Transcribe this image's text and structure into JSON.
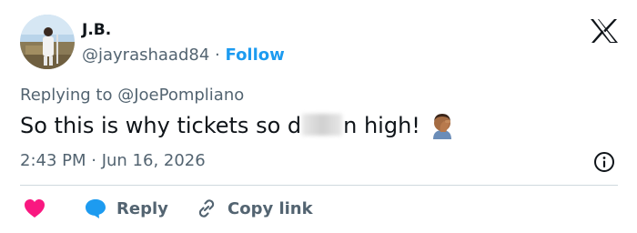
{
  "author": {
    "display_name": "J.B.",
    "handle": "@jayrashaad84",
    "separator": "·",
    "follow_label": "Follow"
  },
  "tweet": {
    "replying_prefix": "Replying to",
    "replying_to": "@JoePompliano",
    "text_before": "So this is why tickets so d",
    "text_after": "n high!",
    "emoji": "man-facepalming-emoji",
    "timestamp": "2:43 PM · Jun 16, 2026"
  },
  "actions": {
    "reply_label": "Reply",
    "copy_link_label": "Copy link"
  },
  "icons": {
    "logo": "x-logo",
    "info": "info-icon",
    "heart": "heart-icon",
    "reply": "reply-bubble-icon",
    "copy": "link-icon"
  },
  "colors": {
    "accent": "#1d9bf0",
    "heart": "#f91880",
    "secondary_text": "#536471",
    "primary_text": "#0f1419",
    "divider": "#cfd9de"
  }
}
